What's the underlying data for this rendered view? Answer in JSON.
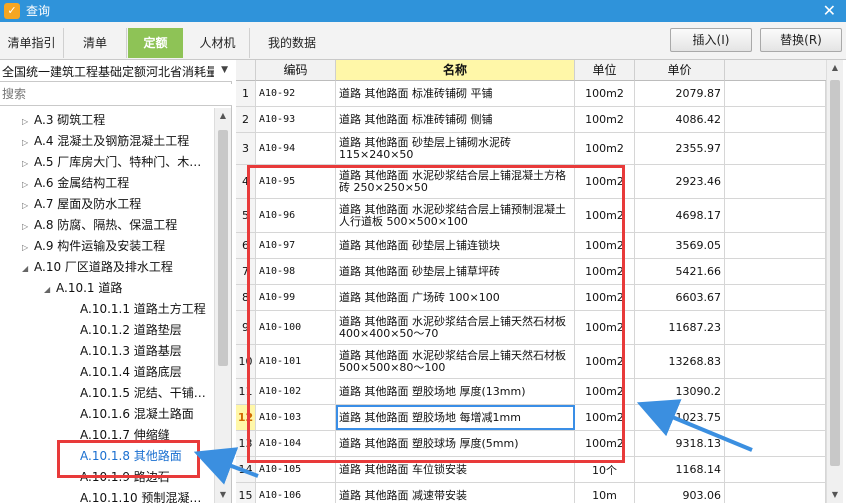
{
  "window": {
    "title": "查询",
    "close_glyph": "✕",
    "app_icon": "app-logo-icon"
  },
  "tabs": [
    {
      "label": "清单指引",
      "active": false
    },
    {
      "label": "清单",
      "active": false
    },
    {
      "label": "定额",
      "active": true
    },
    {
      "label": "人材机",
      "active": false
    },
    {
      "label": "我的数据",
      "active": false
    }
  ],
  "buttons": {
    "insert": "插入(I)",
    "replace": "替换(R)"
  },
  "left_panel": {
    "quota_library": "全国统一建筑工程基础定额河北省消耗量",
    "search_placeholder": "搜索",
    "tree": [
      {
        "label": "A.3 砌筑工程",
        "toggle": "▷"
      },
      {
        "label": "A.4 混凝土及钢筋混凝土工程",
        "toggle": "▷"
      },
      {
        "label": "A.5 厂库房大门、特种门、木…",
        "toggle": "▷"
      },
      {
        "label": "A.6 金属结构工程",
        "toggle": "▷"
      },
      {
        "label": "A.7 屋面及防水工程",
        "toggle": "▷"
      },
      {
        "label": "A.8 防腐、隔热、保温工程",
        "toggle": "▷"
      },
      {
        "label": "A.9 构件运输及安装工程",
        "toggle": "▷"
      },
      {
        "label": "A.10 厂区道路及排水工程",
        "toggle": "◢"
      },
      {
        "label": "A.10.1 道路",
        "toggle": "◢"
      },
      {
        "label": "A.10.1.1 道路土方工程",
        "toggle": ""
      },
      {
        "label": "A.10.1.2 道路垫层",
        "toggle": ""
      },
      {
        "label": "A.10.1.3 道路基层",
        "toggle": ""
      },
      {
        "label": "A.10.1.4 道路底层",
        "toggle": ""
      },
      {
        "label": "A.10.1.5 泥结、干铺…",
        "toggle": ""
      },
      {
        "label": "A.10.1.6 混凝土路面",
        "toggle": ""
      },
      {
        "label": "A.10.1.7 伸缩缝",
        "toggle": ""
      },
      {
        "label": "A.10.1.8 其他路面",
        "toggle": "",
        "selected": true
      },
      {
        "label": "A.10.1.9 路边石",
        "toggle": ""
      },
      {
        "label": "A.10.1.10 预制混凝…",
        "toggle": ""
      }
    ]
  },
  "grid": {
    "columns": [
      "",
      "编码",
      "名称",
      "单位",
      "单价"
    ],
    "rows": [
      {
        "num": "1",
        "code": "A10-92",
        "name": "道路 其他路面 标准砖铺砌 平铺",
        "unit": "100m2",
        "price": "2079.87"
      },
      {
        "num": "2",
        "code": "A10-93",
        "name": "道路 其他路面 标准砖铺砌 侧铺",
        "unit": "100m2",
        "price": "4086.42"
      },
      {
        "num": "3",
        "code": "A10-94",
        "name": "道路 其他路面 砂垫层上铺砌水泥砖 115×240×50",
        "unit": "100m2",
        "price": "2355.97"
      },
      {
        "num": "4",
        "code": "A10-95",
        "name": "道路 其他路面 水泥砂浆结合层上铺混凝土方格砖 250×250×50",
        "unit": "100m2",
        "price": "2923.46"
      },
      {
        "num": "5",
        "code": "A10-96",
        "name": "道路 其他路面 水泥砂浆结合层上铺预制混凝土人行道板 500×500×100",
        "unit": "100m2",
        "price": "4698.17"
      },
      {
        "num": "6",
        "code": "A10-97",
        "name": "道路 其他路面 砂垫层上铺连锁块",
        "unit": "100m2",
        "price": "3569.05"
      },
      {
        "num": "7",
        "code": "A10-98",
        "name": "道路 其他路面 砂垫层上铺草坪砖",
        "unit": "100m2",
        "price": "5421.66"
      },
      {
        "num": "8",
        "code": "A10-99",
        "name": "道路 其他路面 广场砖 100×100",
        "unit": "100m2",
        "price": "6603.67"
      },
      {
        "num": "9",
        "code": "A10-100",
        "name": "道路 其他路面 水泥砂浆结合层上铺天然石材板 400×400×50～70",
        "unit": "100m2",
        "price": "11687.23"
      },
      {
        "num": "10",
        "code": "A10-101",
        "name": "道路 其他路面 水泥砂浆结合层上铺天然石材板 500×500×80～100",
        "unit": "100m2",
        "price": "13268.83"
      },
      {
        "num": "11",
        "code": "A10-102",
        "name": "道路 其他路面 塑胶场地 厚度(13mm)",
        "unit": "100m2",
        "price": "13090.2"
      },
      {
        "num": "12",
        "code": "A10-103",
        "name": "道路 其他路面 塑胶场地 每增减1mm",
        "unit": "100m2",
        "price": "1023.75",
        "current": true
      },
      {
        "num": "13",
        "code": "A10-104",
        "name": "道路 其他路面 塑胶球场 厚度(5mm)",
        "unit": "100m2",
        "price": "9318.13"
      },
      {
        "num": "14",
        "code": "A10-105",
        "name": "道路 其他路面 车位锁安装",
        "unit": "10个",
        "price": "1168.14"
      },
      {
        "num": "15",
        "code": "A10-106",
        "name": "道路 其他路面 减速带安装",
        "unit": "10m",
        "price": "903.06"
      }
    ]
  },
  "colors": {
    "titlebar": "#2f93da",
    "active_tab": "#8ec356",
    "annotation": "#e83a3a",
    "arrow": "#3b8fe0"
  }
}
